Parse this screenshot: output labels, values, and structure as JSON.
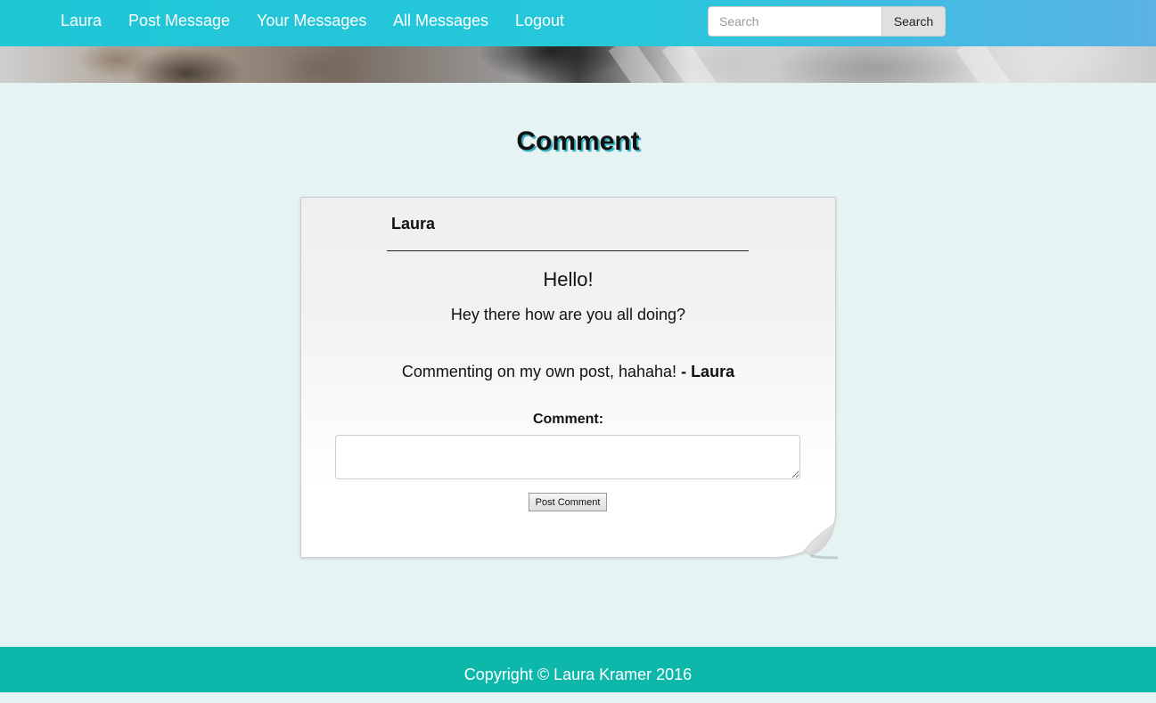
{
  "navbar": {
    "links": [
      "Laura",
      "Post Message",
      "Your Messages",
      "All Messages",
      "Logout"
    ],
    "search": {
      "placeholder": "Search",
      "button_label": "Search"
    },
    "colors": {
      "gradient_start": "#1fc6d6",
      "gradient_end": "#5ab2e6"
    }
  },
  "page": {
    "title": "Comment"
  },
  "card": {
    "author": "Laura",
    "message_title": "Hello!",
    "message_body": "Hey there how are you all doing?",
    "comments": [
      {
        "text": "Commenting on my own post, hahaha!",
        "author_prefix": " - ",
        "author": "Laura"
      }
    ],
    "comment_form": {
      "label": "Comment:",
      "value": "",
      "submit_label": "Post Comment"
    }
  },
  "footer": {
    "text": "Copyright © Laura Kramer 2016",
    "color": "#0db8aa"
  }
}
